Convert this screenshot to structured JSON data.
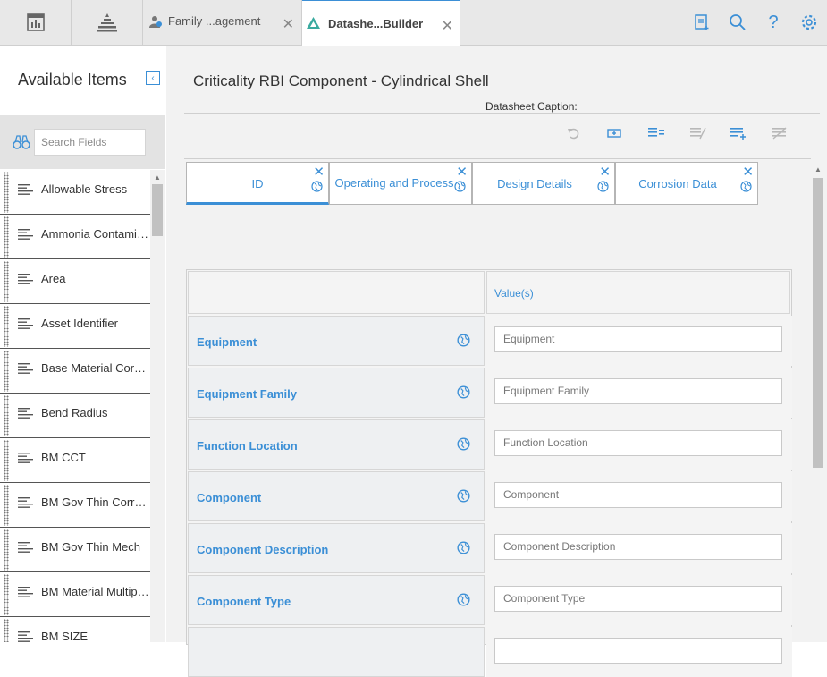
{
  "topbar": {
    "tabs": [
      {
        "label": "Family ...agement"
      },
      {
        "label": "Datashe...Builder"
      }
    ]
  },
  "left_panel": {
    "title": "Available Items",
    "search_placeholder": "Search Fields",
    "items": [
      {
        "label": "Allowable Stress"
      },
      {
        "label": "Ammonia Contamina..."
      },
      {
        "label": "Area"
      },
      {
        "label": "Asset Identifier"
      },
      {
        "label": "Base Material Corros..."
      },
      {
        "label": "Bend Radius"
      },
      {
        "label": "BM CCT"
      },
      {
        "label": "BM Gov Thin Corr Rat..."
      },
      {
        "label": "BM Gov Thin Mech"
      },
      {
        "label": "BM Material Multiplier"
      },
      {
        "label": "BM SIZE"
      }
    ]
  },
  "main": {
    "title": "Criticality RBI Component - Cylindrical Shell",
    "caption_label": "Datasheet Caption:",
    "tabs": [
      {
        "label": "ID"
      },
      {
        "label": "Operating and Process"
      },
      {
        "label": "Design Details"
      },
      {
        "label": "Corrosion Data"
      }
    ],
    "grid": {
      "value_header": "Value(s)",
      "rows": [
        {
          "label": "Equipment",
          "placeholder": "Equipment"
        },
        {
          "label": "Equipment Family",
          "placeholder": "Equipment Family"
        },
        {
          "label": "Function Location",
          "placeholder": "Function Location"
        },
        {
          "label": "Component",
          "placeholder": "Component"
        },
        {
          "label": "Component Description",
          "placeholder": "Component Description"
        },
        {
          "label": "Component Type",
          "placeholder": "Component Type"
        },
        {
          "label": "",
          "placeholder": ""
        }
      ]
    }
  },
  "colors": {
    "accent": "#3b8fd6",
    "topbar": "#e8e8e8",
    "canvas": "#f2f2f2"
  }
}
